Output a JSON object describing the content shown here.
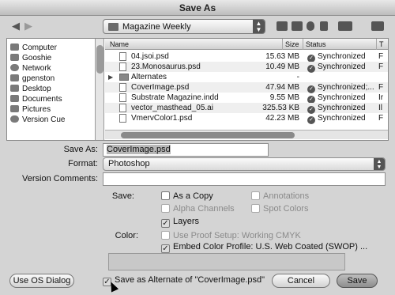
{
  "window": {
    "title": "Save As"
  },
  "toolbar": {
    "back_icon": "back-arrow-icon",
    "forward_icon": "forward-arrow-icon",
    "location": "Magazine Weekly",
    "icons": [
      "new-folder-icon",
      "add-folder-icon",
      "refresh-icon",
      "trash-icon",
      "action-icon",
      "view-options-icon"
    ]
  },
  "sidebar": {
    "items": [
      {
        "label": "Computer",
        "icon": "computer-icon"
      },
      {
        "label": "Gooshie",
        "icon": "drive-icon"
      },
      {
        "label": "Network",
        "icon": "network-icon"
      },
      {
        "label": "gpenston",
        "icon": "home-icon"
      },
      {
        "label": "Desktop",
        "icon": "desktop-icon"
      },
      {
        "label": "Documents",
        "icon": "documents-icon"
      },
      {
        "label": "Pictures",
        "icon": "pictures-icon"
      },
      {
        "label": "Version Cue",
        "icon": "version-cue-icon"
      }
    ]
  },
  "file_list": {
    "columns": [
      "Name",
      "Size",
      "Status",
      "T"
    ],
    "rows": [
      {
        "name": "04.jsoi.psd",
        "size": "15.63 MB",
        "status": "Synchronized",
        "type": "F",
        "folder": false
      },
      {
        "name": "23.Monosaurus.psd",
        "size": "10.49 MB",
        "status": "Synchronized",
        "type": "F",
        "folder": false
      },
      {
        "name": "Alternates",
        "size": "-",
        "status": "",
        "type": "",
        "folder": true
      },
      {
        "name": "CoverImage.psd",
        "size": "47.94 MB",
        "status": "Synchronized;...",
        "type": "F",
        "folder": false
      },
      {
        "name": "Substrate Magazine.indd",
        "size": "9.55 MB",
        "status": "Synchronized",
        "type": "Ir",
        "folder": false
      },
      {
        "name": "vector_masthead_05.ai",
        "size": "325.53 KB",
        "status": "Synchronized",
        "type": "Il",
        "folder": false
      },
      {
        "name": "VmervColor1.psd",
        "size": "42.23 MB",
        "status": "Synchronized",
        "type": "F",
        "folder": false
      }
    ]
  },
  "form": {
    "save_as_label": "Save As:",
    "save_as_value": "CoverImage.psd",
    "format_label": "Format:",
    "format_value": "Photoshop",
    "version_comments_label": "Version Comments:",
    "version_comments_value": "",
    "save_label": "Save:",
    "color_label": "Color:",
    "options": {
      "as_a_copy": {
        "label": "As a Copy",
        "checked": false,
        "enabled": true
      },
      "annotations": {
        "label": "Annotations",
        "checked": false,
        "enabled": false
      },
      "alpha_channels": {
        "label": "Alpha Channels",
        "checked": false,
        "enabled": false
      },
      "spot_colors": {
        "label": "Spot Colors",
        "checked": false,
        "enabled": false
      },
      "layers": {
        "label": "Layers",
        "checked": true,
        "enabled": true
      },
      "use_proof_setup": {
        "label": "Use Proof Setup:  Working CMYK",
        "checked": false,
        "enabled": false
      },
      "embed_color_profile": {
        "label": "Embed Color Profile:  U.S. Web Coated (SWOP) ...",
        "checked": true,
        "enabled": true
      }
    }
  },
  "footer": {
    "use_os_dialog": "Use OS Dialog",
    "save_as_alternate": {
      "label": "Save as Alternate of \"CoverImage.psd\"",
      "checked": true
    },
    "cancel": "Cancel",
    "save": "Save"
  }
}
